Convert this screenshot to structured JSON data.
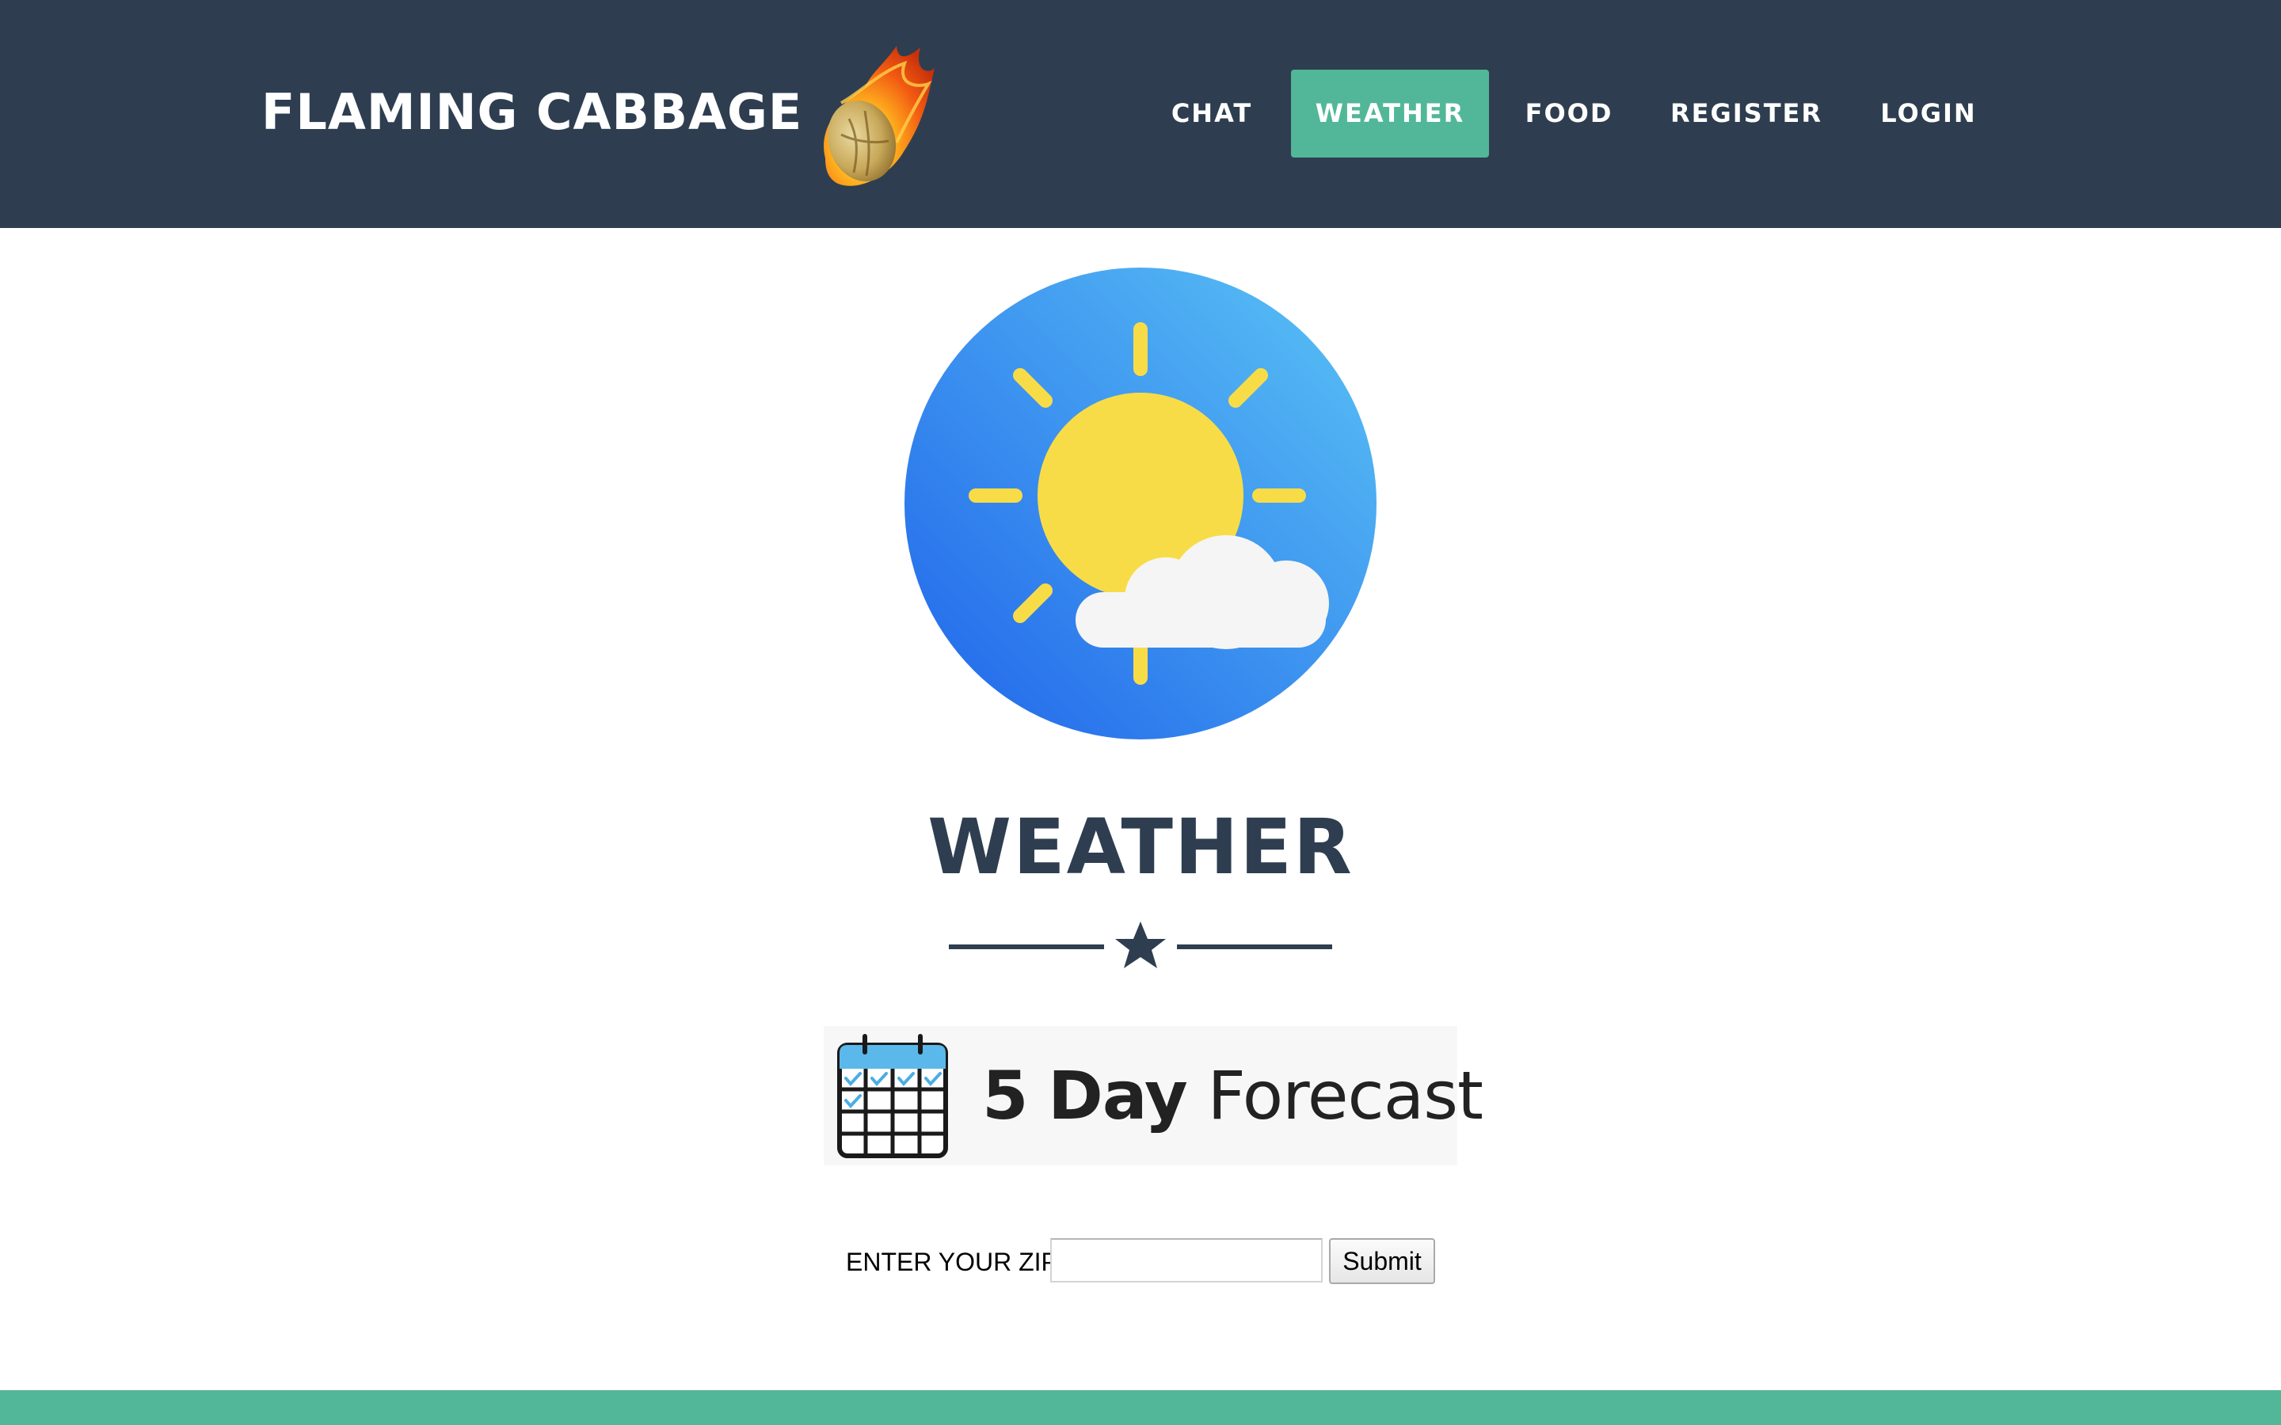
{
  "navbar": {
    "brand": "FLAMING CABBAGE",
    "brand_logo_icon": "flaming-cabbage-meteor-icon",
    "items": [
      {
        "label": "CHAT",
        "active": false
      },
      {
        "label": "WEATHER",
        "active": true
      },
      {
        "label": "FOOD",
        "active": false
      },
      {
        "label": "REGISTER",
        "active": false
      },
      {
        "label": "LOGIN",
        "active": false
      }
    ],
    "background_color": "#2e3e50",
    "active_color": "#52b798"
  },
  "masthead": {
    "icon": "sun-cloud-weather-icon",
    "title": "WEATHER",
    "divider_icon": "star-icon"
  },
  "forecast_banner": {
    "icon": "calendar-icon",
    "number": "5",
    "bold_word": "Day",
    "word": "Forecast"
  },
  "zip_form": {
    "label": "ENTER YOUR ZIP",
    "value": "",
    "submit_label": "Submit"
  },
  "footer": {
    "color": "#52b798"
  }
}
